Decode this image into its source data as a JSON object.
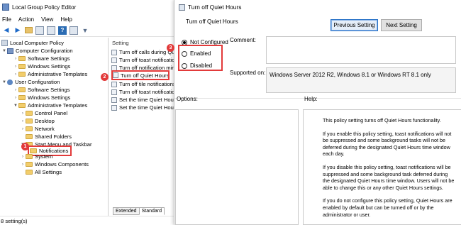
{
  "editor": {
    "title": "Local Group Policy Editor",
    "menu": [
      "File",
      "Action",
      "View",
      "Help"
    ],
    "status": "8 setting(s)"
  },
  "tree": [
    {
      "label": "Local Computer Policy",
      "icon": "computer-policy-icon"
    },
    {
      "label": "Computer Configuration",
      "icon": "computer-icon"
    },
    {
      "label": "Software Settings",
      "icon": "folder-icon"
    },
    {
      "label": "Windows Settings",
      "icon": "folder-icon"
    },
    {
      "label": "Administrative Templates",
      "icon": "folder-icon"
    },
    {
      "label": "User Configuration",
      "icon": "user-icon"
    },
    {
      "label": "Software Settings",
      "icon": "folder-icon"
    },
    {
      "label": "Windows Settings",
      "icon": "folder-icon"
    },
    {
      "label": "Administrative Templates",
      "icon": "folder-icon"
    },
    {
      "label": "Control Panel",
      "icon": "folder-icon"
    },
    {
      "label": "Desktop",
      "icon": "folder-icon"
    },
    {
      "label": "Network",
      "icon": "folder-icon"
    },
    {
      "label": "Shared Folders",
      "icon": "folder-icon"
    },
    {
      "label": "Start Menu and Taskbar",
      "icon": "folder-icon"
    },
    {
      "label": "Notifications",
      "icon": "folder-icon",
      "selected": true
    },
    {
      "label": "System",
      "icon": "folder-icon"
    },
    {
      "label": "Windows Components",
      "icon": "folder-icon"
    },
    {
      "label": "All Settings",
      "icon": "folder-icon"
    }
  ],
  "list": {
    "header": "Setting",
    "items": [
      "Turn off calls during Quiet Hours",
      "Turn off toast notifications",
      "Turn off notification mirroring",
      "Turn off Quiet Hours",
      "Turn off tile notifications",
      "Turn off toast notifications on the lock screen",
      "Set the time Quiet Hours begins each day",
      "Set the time Quiet Hours ends each day"
    ],
    "tabs": [
      "Extended",
      "Standard"
    ]
  },
  "badges": [
    "1",
    "2",
    "3"
  ],
  "dialog": {
    "title": "Turn off Quiet Hours",
    "subtitle": "Turn off Quiet Hours",
    "prev_button": "Previous Setting",
    "next_button": "Next Setting",
    "radios": [
      "Not Configured",
      "Enabled",
      "Disabled"
    ],
    "selected_radio": "Not Configured",
    "comment_label": "Comment:",
    "comment_value": "",
    "supported_label": "Supported on:",
    "supported_value": "Windows Server 2012 R2, Windows 8.1 or Windows RT 8.1 only",
    "options_label": "Options:",
    "help_label": "Help:",
    "help_paragraphs": [
      "This policy setting turns off Quiet Hours functionality.",
      "If you enable this policy setting, toast notifications will not be suppressed and some background tasks will not be deferred during the designated Quiet Hours time window each day.",
      "If you disable this policy setting, toast notifications will be suppressed and some background task deferred during the designated Quiet Hours time window.  Users will not be able to change this or any other Quiet Hours settings.",
      "If you do not configure this policy setting, Quiet Hours are enabled by default but can be turned off or by the administrator or user."
    ]
  },
  "colors": {
    "highlight": "#e23a3a",
    "primary_button_border": "#2a73c8"
  }
}
